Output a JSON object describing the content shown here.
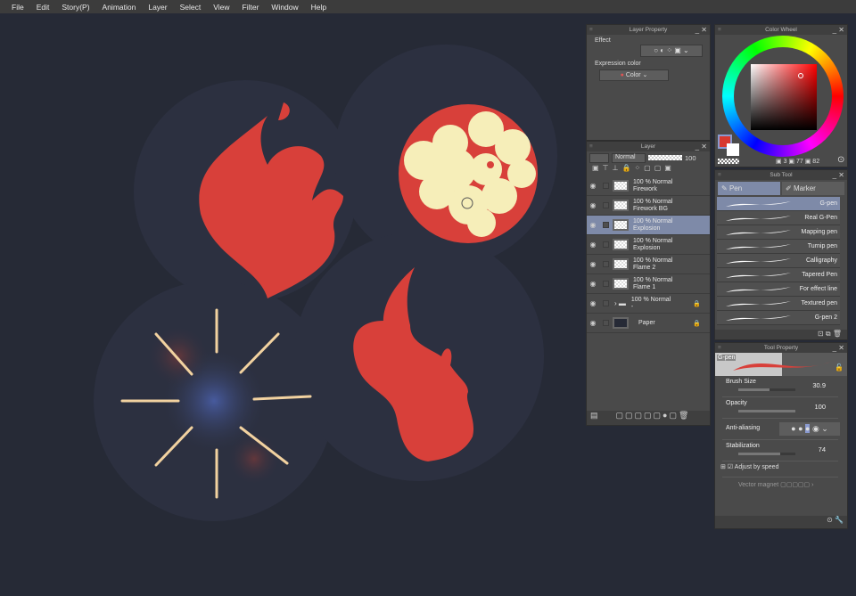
{
  "menu": [
    "File",
    "Edit",
    "Story(P)",
    "Animation",
    "Layer",
    "Select",
    "View",
    "Filter",
    "Window",
    "Help"
  ],
  "layer_property": {
    "title": "Layer Property",
    "effect_label": "Effect",
    "expression_label": "Expression color",
    "expression_value": "Color"
  },
  "layer": {
    "title": "Layer",
    "blend_mode": "Normal",
    "opacity": "100",
    "rows": [
      {
        "mode": "100 % Normal",
        "name": "Firework"
      },
      {
        "mode": "100 % Normal",
        "name": "Firework BG"
      },
      {
        "mode": "100 % Normal",
        "name": "Explosion",
        "selected": true
      },
      {
        "mode": "100 % Normal",
        "name": "Explosion"
      },
      {
        "mode": "100 % Normal",
        "name": "Flame 2"
      },
      {
        "mode": "100 % Normal",
        "name": "Flame 1"
      },
      {
        "mode": "100 % Normal",
        "name": "-"
      },
      {
        "mode": "",
        "name": "Paper"
      }
    ]
  },
  "color_wheel": {
    "title": "Color Wheel",
    "h": "3",
    "s": "77",
    "v": "82",
    "main_color": "#d8382e",
    "sub_color": "#ffffff"
  },
  "sub_tool": {
    "title": "Sub Tool",
    "tabs": [
      "Pen",
      "Marker"
    ],
    "brushes": [
      "G-pen",
      "Real G-Pen",
      "Mapping pen",
      "Turnip pen",
      "Calligraphy",
      "Tapered Pen",
      "For effect line",
      "Textured pen",
      "G-pen 2"
    ]
  },
  "tool_property": {
    "title": "Tool Property",
    "tool_name": "G-pen",
    "brush_size_label": "Brush Size",
    "brush_size": "30.9",
    "brush_size_fraction": 0.55,
    "opacity_label": "Opacity",
    "opacity": "100",
    "opacity_fraction": 1.0,
    "antialias_label": "Anti-aliasing",
    "stabilization_label": "Stabilization",
    "stabilization": "74",
    "stabilization_fraction": 0.74,
    "adjust_speed_label": "Adjust by speed",
    "vector_magnet_label": "Vector magnet"
  },
  "colors": {
    "flame": "#d8403a",
    "explosion_fill": "#f6eeb9",
    "bg": "#262a36"
  }
}
